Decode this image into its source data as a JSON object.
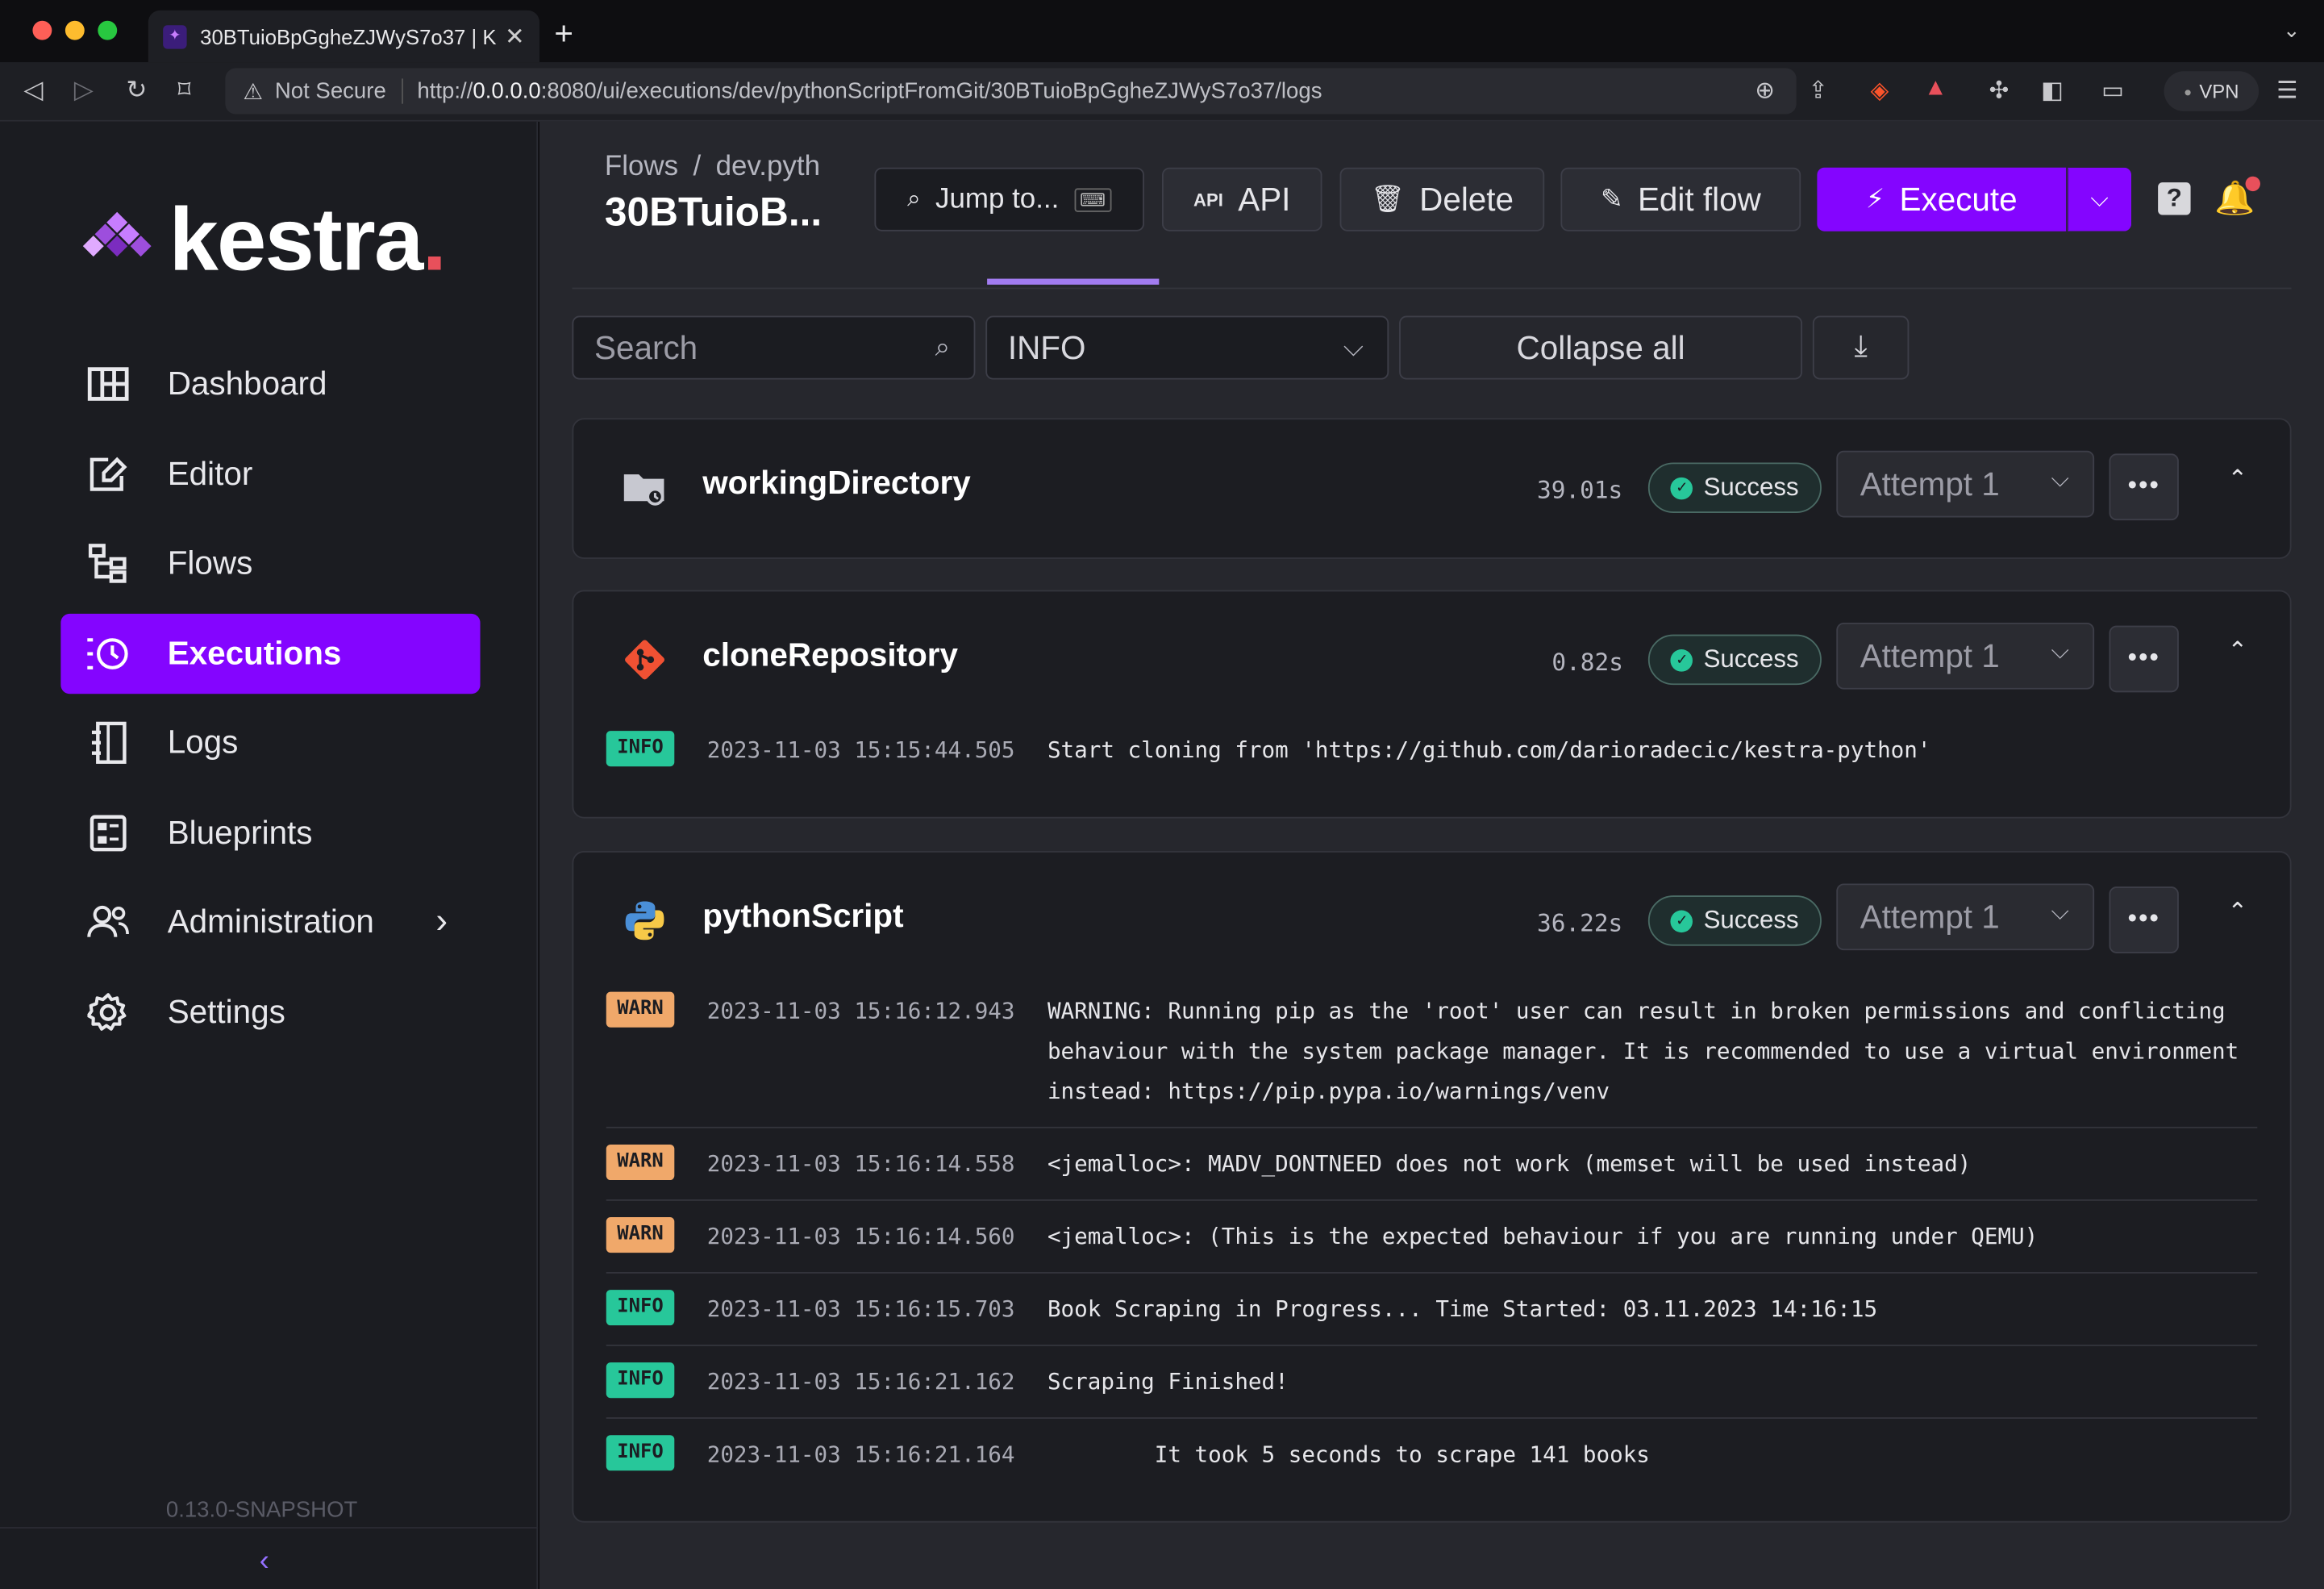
{
  "browser": {
    "tab_title": "30BTuioBpGgheZJWyS7o37 | K",
    "security": "Not Secure",
    "url_prefix": "http://",
    "url_host": "0.0.0.0",
    "url_rest": ":8080/ui/executions/dev/pythonScriptFromGit/30BTuioBpGgheZJWyS7o37/logs",
    "vpn_label": "VPN"
  },
  "sidebar": {
    "logo": "kestra",
    "items": [
      {
        "label": "Dashboard",
        "icon": "dashboard-icon"
      },
      {
        "label": "Editor",
        "icon": "editor-icon"
      },
      {
        "label": "Flows",
        "icon": "flows-icon"
      },
      {
        "label": "Executions",
        "icon": "executions-icon",
        "active": true
      },
      {
        "label": "Logs",
        "icon": "logs-icon"
      },
      {
        "label": "Blueprints",
        "icon": "blueprints-icon"
      },
      {
        "label": "Administration",
        "icon": "administration-icon"
      },
      {
        "label": "Settings",
        "icon": "gear-icon"
      }
    ],
    "version": "0.13.0-SNAPSHOT"
  },
  "header": {
    "breadcrumb_root": "Flows",
    "breadcrumb_namespace": "dev.pyth",
    "title": "30BTuioB...",
    "jump_label": "Jump to...",
    "api_label": "API",
    "delete_label": "Delete",
    "edit_label": "Edit flow",
    "execute_label": "Execute"
  },
  "filters": {
    "search_placeholder": "Search",
    "level": "INFO",
    "collapse_label": "Collapse all"
  },
  "tasks": [
    {
      "name": "workingDirectory",
      "duration": "39.01s",
      "status": "Success",
      "attempt": "Attempt 1",
      "logs": []
    },
    {
      "name": "cloneRepository",
      "duration": "0.82s",
      "status": "Success",
      "attempt": "Attempt 1",
      "logs": [
        {
          "level": "INFO",
          "time": "2023-11-03 15:15:44.505",
          "message": "Start cloning from 'https://github.com/darioradecic/kestra-python'"
        }
      ]
    },
    {
      "name": "pythonScript",
      "duration": "36.22s",
      "status": "Success",
      "attempt": "Attempt 1",
      "logs": [
        {
          "level": "WARN",
          "time": "2023-11-03 15:16:12.943",
          "message": "WARNING: Running pip as the 'root' user can result in broken permissions and conflicting behaviour with the system package manager. It is recommended to use a virtual environment instead: https://pip.pypa.io/warnings/venv"
        },
        {
          "level": "WARN",
          "time": "2023-11-03 15:16:14.558",
          "message": "<jemalloc>: MADV_DONTNEED does not work (memset will be used instead)"
        },
        {
          "level": "WARN",
          "time": "2023-11-03 15:16:14.560",
          "message": "<jemalloc>: (This is the expected behaviour if you are running under QEMU)"
        },
        {
          "level": "INFO",
          "time": "2023-11-03 15:16:15.703",
          "message": "Book Scraping in Progress... Time Started: 03.11.2023 14:16:15"
        },
        {
          "level": "INFO",
          "time": "2023-11-03 15:16:21.162",
          "message": "Scraping Finished!"
        },
        {
          "level": "INFO",
          "time": "2023-11-03 15:16:21.164",
          "message": "        It took 5 seconds to scrape 141 books"
        }
      ]
    }
  ]
}
